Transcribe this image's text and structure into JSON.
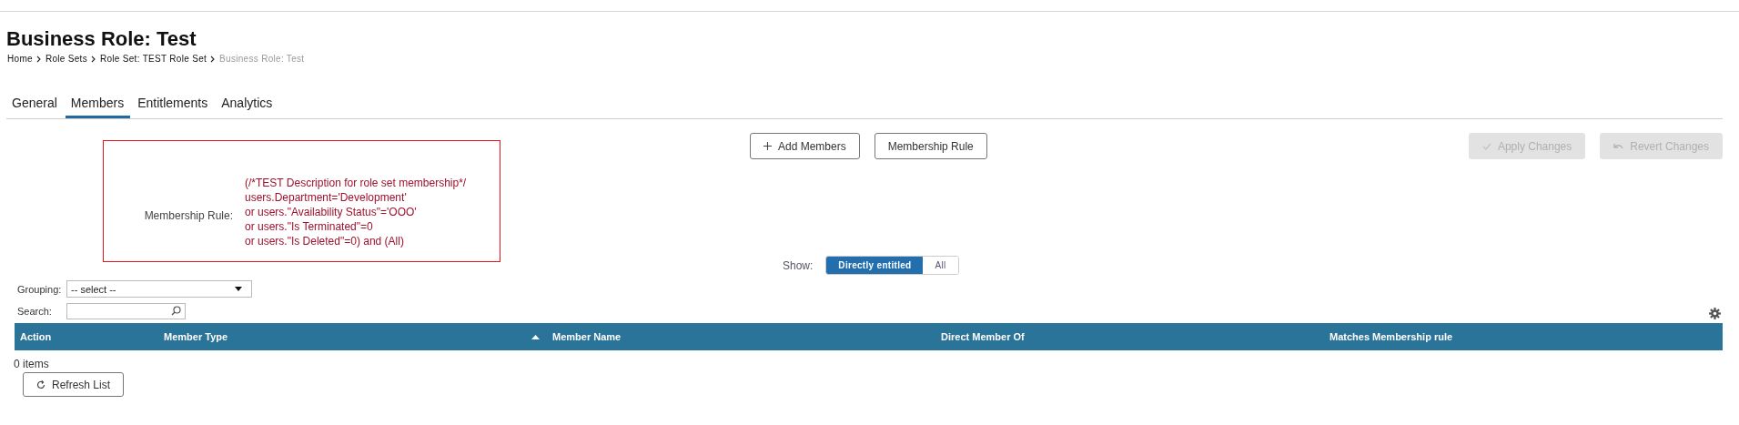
{
  "page": {
    "title": "Business Role: Test"
  },
  "breadcrumb": [
    {
      "label": "Home",
      "current": false
    },
    {
      "label": "Role Sets",
      "current": false
    },
    {
      "label": "Role Set: TEST Role Set",
      "current": false
    },
    {
      "label": "Business Role: Test",
      "current": true
    }
  ],
  "tabs": [
    {
      "label": "General",
      "selected": false
    },
    {
      "label": "Members",
      "selected": true
    },
    {
      "label": "Entitlements",
      "selected": false
    },
    {
      "label": "Analytics",
      "selected": false
    }
  ],
  "membership_rule": {
    "label": "Membership Rule:",
    "lines": [
      "(/*TEST Description for role set membership*/",
      "users.Department='Development'",
      "or users.\"Availability Status\"='OOO'",
      "or users.\"Is Terminated\"=0",
      "or users.\"Is Deleted\"=0) and (All)"
    ]
  },
  "actions": [
    {
      "label": "Add Members",
      "kind": "add",
      "disabled": false
    },
    {
      "label": "Membership Rule",
      "kind": "plain",
      "disabled": false
    }
  ],
  "change_actions": [
    {
      "label": "Apply Changes",
      "kind": "apply",
      "disabled": true
    },
    {
      "label": "Revert Changes",
      "kind": "revert",
      "disabled": true
    }
  ],
  "show": {
    "label": "Show:",
    "options": [
      {
        "label": "Directly entitled",
        "selected": true
      },
      {
        "label": "All",
        "selected": false
      }
    ]
  },
  "grouping": {
    "label": "Grouping:",
    "value": "-- select --"
  },
  "search": {
    "label": "Search:"
  },
  "table": {
    "columns": [
      {
        "label": "Action",
        "sorted": false
      },
      {
        "label": "Member Type",
        "sorted": true
      },
      {
        "label": "Member Name",
        "sorted": false
      },
      {
        "label": "Direct Member Of",
        "sorted": false
      },
      {
        "label": "Matches Membership rule",
        "sorted": false
      }
    ]
  },
  "item_count": "0 items",
  "refresh_button": "Refresh List"
}
